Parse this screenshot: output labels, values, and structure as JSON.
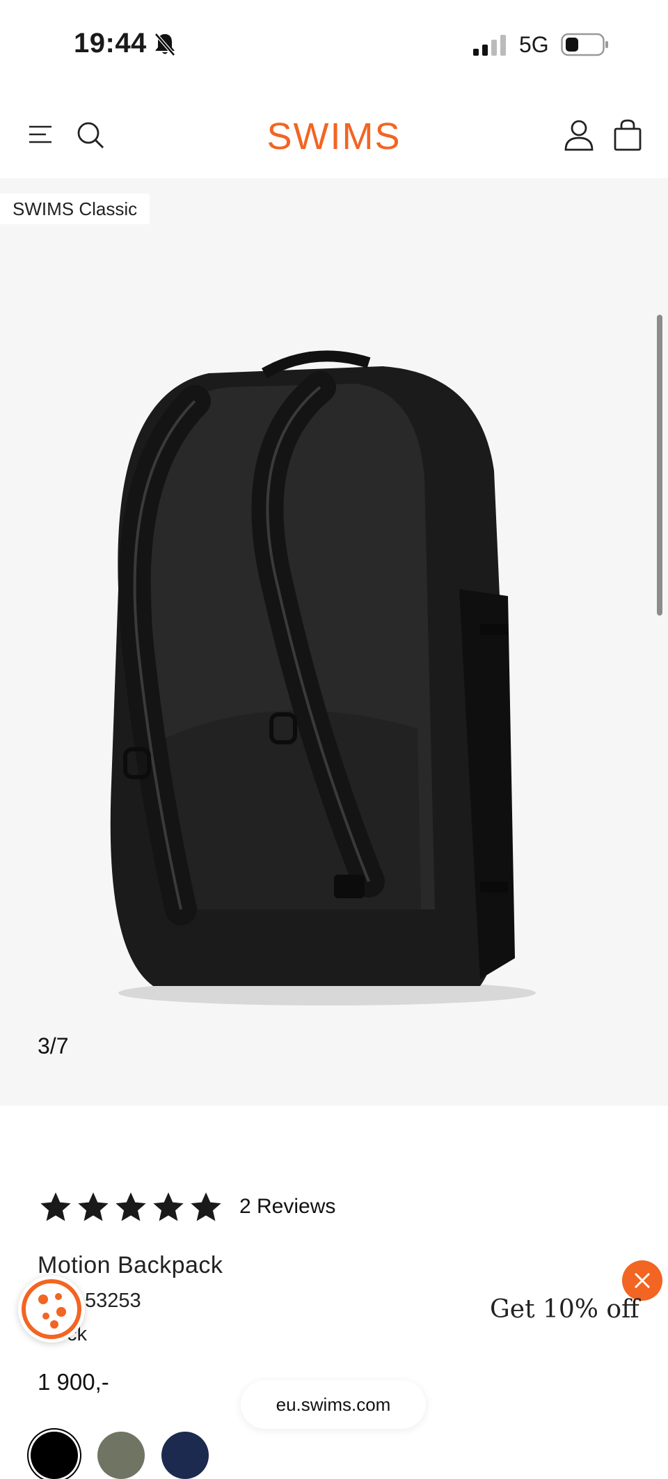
{
  "status_bar": {
    "time": "19:44",
    "network": "5G"
  },
  "header": {
    "brand": "SWIMS"
  },
  "gallery": {
    "badge": "SWIMS Classic",
    "counter": "3/7"
  },
  "product": {
    "rating_stars": 5,
    "reviews": "2 Reviews",
    "title": "Motion Backpack",
    "sku": "53253",
    "color": "ck",
    "price": "1 900,-",
    "swatches": [
      {
        "name": "Black",
        "hex": "#000000"
      },
      {
        "name": "Olive",
        "hex": "#6f7562"
      },
      {
        "name": "Navy",
        "hex": "#1c2a4f"
      }
    ]
  },
  "promo": {
    "text": "Get 10% off"
  },
  "browser": {
    "url": "eu.swims.com"
  },
  "colors": {
    "accent": "#f26522",
    "gallery_bg": "#f6f6f6"
  },
  "icons": [
    "bell-slash-icon",
    "signal-icon",
    "battery-icon",
    "menu-icon",
    "search-icon",
    "account-icon",
    "bag-icon",
    "star-icon",
    "cookie-icon",
    "close-icon"
  ]
}
